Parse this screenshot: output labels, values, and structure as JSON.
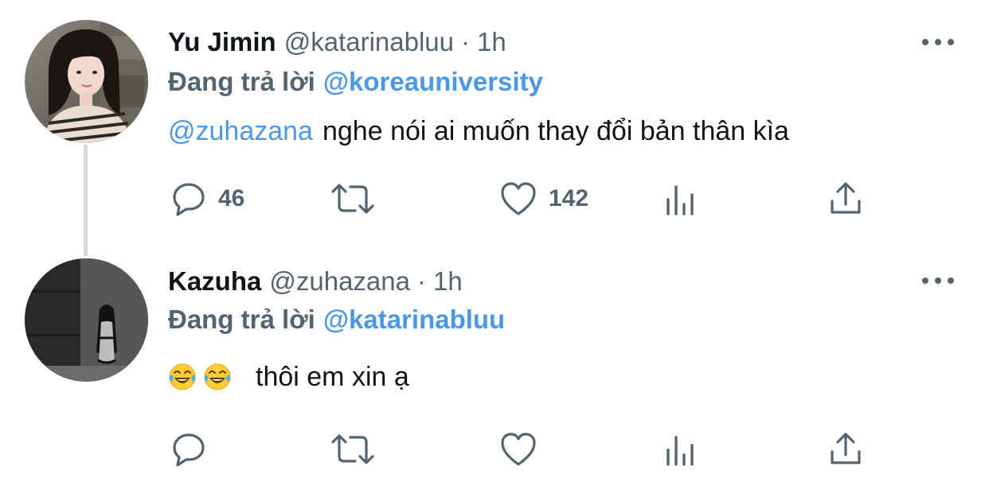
{
  "tweets": [
    {
      "name": "Yu Jimin",
      "handle": "@katarinabluu",
      "separator": "·",
      "time": "1h",
      "replying_prefix": "Đang trả lời",
      "replying_to": "@koreauniversity",
      "text_mention": "@zuhazana",
      "text": "nghe nói ai muốn thay đổi bản thân kìa",
      "reply_count": "46",
      "like_count": "142"
    },
    {
      "name": "Kazuha",
      "handle": "@zuhazana",
      "separator": "·",
      "time": "1h",
      "replying_prefix": "Đang trả lời",
      "replying_to": "@katarinabluu",
      "emojis": [
        "face-with-tears-of-joy",
        "face-with-tears-of-joy"
      ],
      "text": "thôi em xin ạ"
    }
  ],
  "colors": {
    "text": "#0f1419",
    "secondary": "#536471",
    "link": "#4a99e9",
    "thread_line": "#cfd9de"
  },
  "icons": [
    "reply-icon",
    "retweet-icon",
    "like-icon",
    "analytics-icon",
    "share-icon",
    "more-icon"
  ]
}
